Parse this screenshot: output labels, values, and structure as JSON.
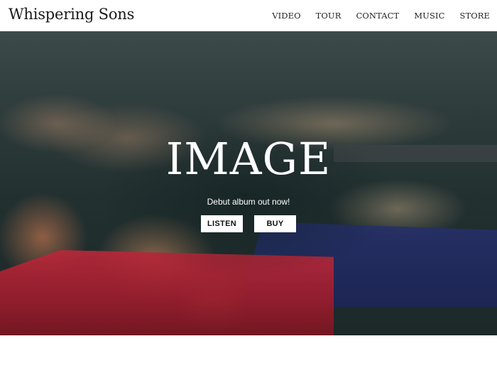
{
  "header": {
    "brand": "Whispering Sons",
    "nav": [
      {
        "label": "VIDEO"
      },
      {
        "label": "TOUR"
      },
      {
        "label": "CONTACT"
      },
      {
        "label": "MUSIC"
      },
      {
        "label": "STORE"
      }
    ]
  },
  "hero": {
    "title": "IMAGE",
    "subtitle": "Debut album out now!",
    "listen_label": "LISTEN",
    "buy_label": "BUY"
  },
  "colors": {
    "header_bg": "#ffffff",
    "text_dark": "#1a1a1a",
    "hero_text": "#ffffff",
    "button_bg": "#ffffff"
  }
}
